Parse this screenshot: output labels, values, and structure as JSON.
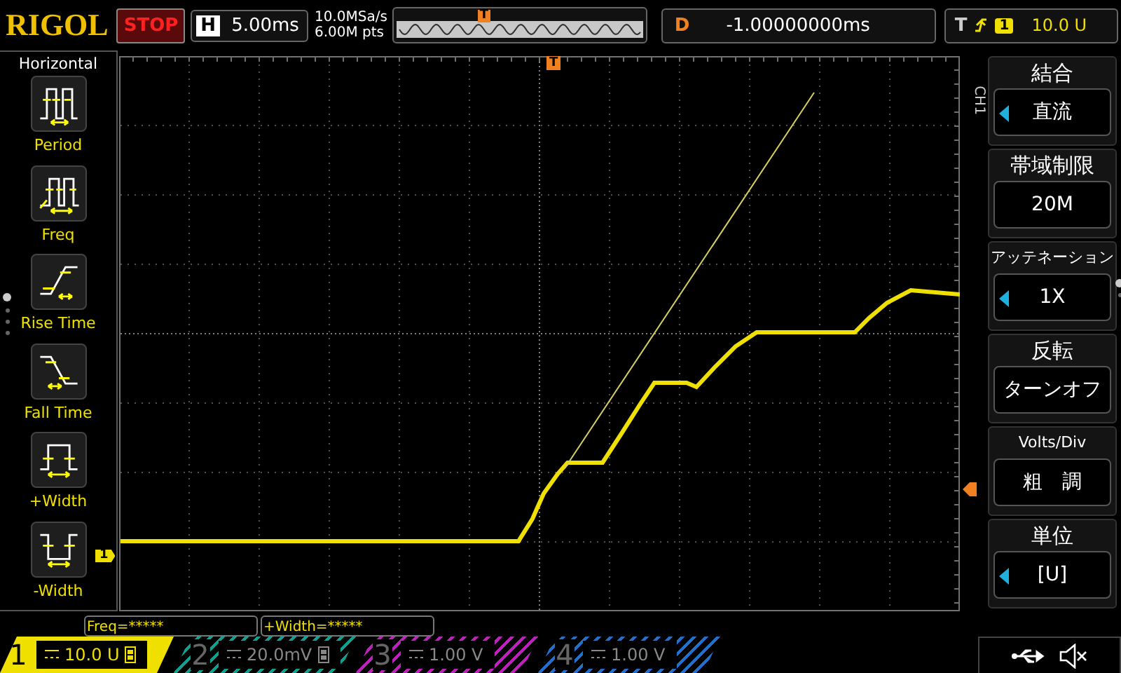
{
  "top_bar": {
    "brand": "RIGOL",
    "run_state": "STOP",
    "timebase": {
      "label": "H",
      "value": "5.00ms"
    },
    "sample_rate": "10.0MSa/s",
    "memory_depth": "6.00M pts",
    "overview_marker": "T",
    "delay": {
      "label": "D",
      "value": "-1.00000000ms"
    },
    "trigger": {
      "label": "T",
      "source": "1",
      "level": "10.0 U"
    }
  },
  "left_menu": {
    "title": "Horizontal",
    "items": [
      {
        "kind": "period",
        "label": "Period"
      },
      {
        "kind": "freq",
        "label": "Freq"
      },
      {
        "kind": "rise",
        "label": "Rise Time"
      },
      {
        "kind": "fall",
        "label": "Fall Time"
      },
      {
        "kind": "pwidth",
        "label": "+Width"
      },
      {
        "kind": "nwidth",
        "label": "-Width"
      }
    ],
    "pages": [
      {
        "selected": true
      },
      {
        "selected": false
      },
      {
        "selected": false
      },
      {
        "selected": false
      }
    ]
  },
  "display": {
    "trigger_marker": "T",
    "channel_marker": "1"
  },
  "right_menu": {
    "channel_label": "CH1",
    "items": [
      {
        "title": "結合",
        "value": "直流",
        "adjustable": true
      },
      {
        "title": "帯域制限",
        "value": "20M",
        "adjustable": false
      },
      {
        "title": "アッテネーション",
        "value": "1X",
        "adjustable": true
      },
      {
        "title": "反転",
        "value": "ターンオフ",
        "adjustable": false
      },
      {
        "title": "Volts/Div",
        "value": "粗　調",
        "adjustable": false
      },
      {
        "title": "単位",
        "value": "[U]",
        "adjustable": true
      }
    ],
    "pages": [
      {
        "selected": true
      },
      {
        "selected": false
      }
    ]
  },
  "measurements": [
    "Freq=*****",
    "+Width=*****"
  ],
  "channels": [
    {
      "number": "1",
      "scale": "10.0 U",
      "on": true,
      "bw_limit": true,
      "color": "#f0e000"
    },
    {
      "number": "2",
      "scale": "20.0mV",
      "on": false,
      "bw_limit": true,
      "color": "#10a090"
    },
    {
      "number": "3",
      "scale": "1.00 V",
      "on": false,
      "bw_limit": false,
      "color": "#c020c0"
    },
    {
      "number": "4",
      "scale": "1.00 V",
      "on": false,
      "bw_limit": false,
      "color": "#2070d0"
    }
  ]
}
